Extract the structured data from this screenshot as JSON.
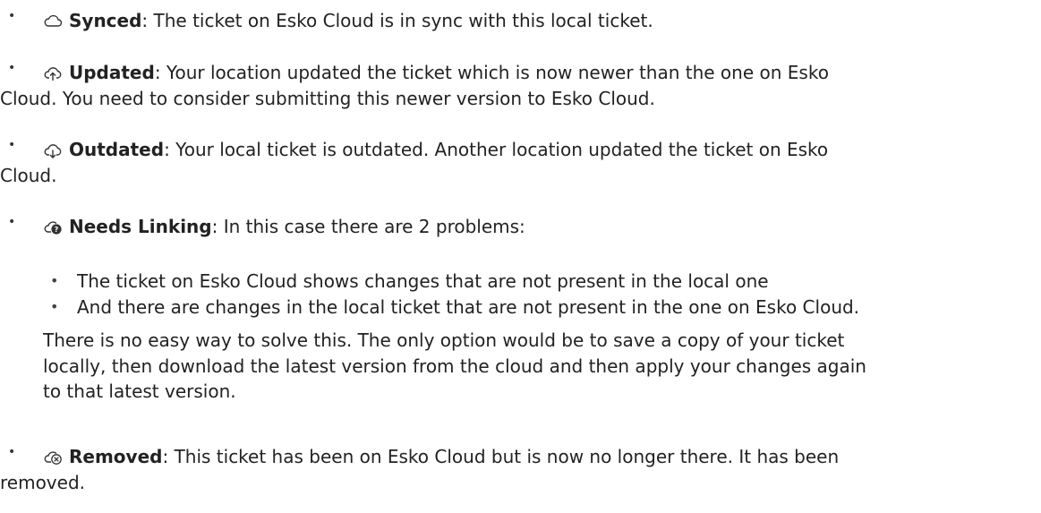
{
  "items": [
    {
      "icon": "cloud-synced-icon",
      "name": "Synced",
      "desc_lines": [
        ": The ticket on Esko Cloud is in sync with this local ticket."
      ]
    },
    {
      "icon": "cloud-upload-icon",
      "name": "Updated",
      "desc_lines": [
        ": Your location updated the ticket which is now newer than the one on Esko",
        "Cloud. You need to consider submitting this newer version to Esko Cloud."
      ]
    },
    {
      "icon": "cloud-download-icon",
      "name": "Outdated",
      "desc_lines": [
        ": Your local ticket is outdated. Another location updated the ticket on Esko",
        "Cloud."
      ]
    },
    {
      "icon": "cloud-question-icon",
      "name": "Needs Linking",
      "desc_lines": [
        ": In this case there are 2 problems:"
      ],
      "sub_items": [
        "The ticket on Esko Cloud shows changes that are not present in the local one",
        "And there are changes in the local ticket that are not present in the one on Esko Cloud."
      ],
      "note_lines": [
        "There is no easy way to solve this. The only option would be to save a copy of your ticket",
        "locally, then download the latest version from the cloud and then apply your changes again",
        "to that latest version."
      ]
    },
    {
      "icon": "cloud-removed-icon",
      "name": "Removed",
      "desc_lines": [
        ": This ticket has been on Esko Cloud but is now no longer there. It has been",
        "removed."
      ]
    }
  ]
}
